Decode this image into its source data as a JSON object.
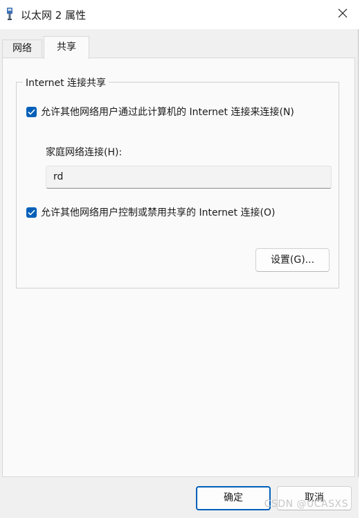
{
  "window": {
    "title": "以太网 2 属性"
  },
  "tabs": [
    {
      "label": "网络"
    },
    {
      "label": "共享",
      "selected": true
    }
  ],
  "sharing": {
    "group_title": "Internet 连接共享",
    "allow_connection": {
      "label": "允许其他网络用户通过此计算机的 Internet 连接来连接(N)",
      "checked": true
    },
    "home_network_label": "家庭网络连接(H):",
    "home_network_value": "rd",
    "allow_control": {
      "label": "允许其他网络用户控制或禁用共享的 Internet 连接(O)",
      "checked": true
    },
    "settings_button": "设置(G)..."
  },
  "footer": {
    "ok_button": "确定",
    "cancel_button": "取消"
  },
  "watermark": "CSDN @UCASXS",
  "colors": {
    "accent": "#005fb8",
    "window_bg": "#f0f0f0",
    "panel_bg": "#fafafa"
  }
}
